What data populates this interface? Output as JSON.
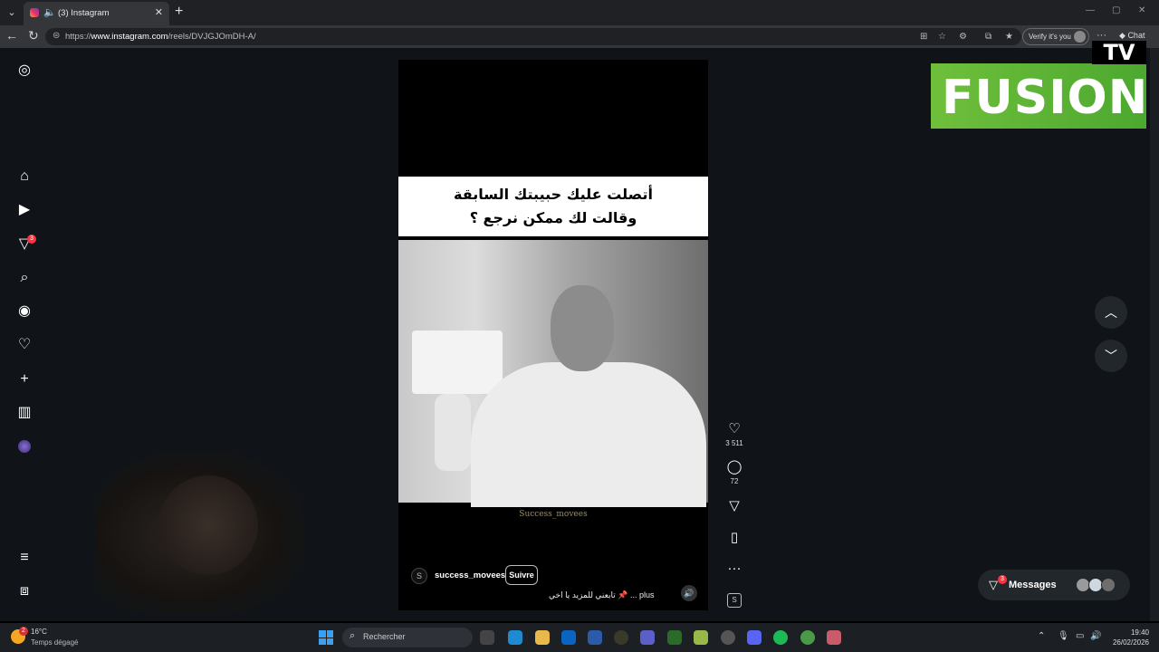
{
  "browser": {
    "tab_title": "(3) Instagram",
    "tab_favicon": "instagram-icon",
    "url_prefix": "https://",
    "url_domain": "www.instagram.com",
    "url_path": "/reels/DVJGJOmDH-A/",
    "verify_label": "Verify it's you",
    "chat_label": "Chat"
  },
  "sidebar": {
    "items": [
      {
        "name": "instagram-logo-icon"
      },
      {
        "name": "home-icon"
      },
      {
        "name": "reels-icon"
      },
      {
        "name": "direct-icon",
        "badge": "3"
      },
      {
        "name": "search-icon"
      },
      {
        "name": "explore-icon"
      },
      {
        "name": "heart-icon"
      },
      {
        "name": "plus-icon"
      },
      {
        "name": "insights-icon"
      },
      {
        "name": "profile-avatar"
      },
      {
        "name": "menu-icon"
      },
      {
        "name": "threads-icon"
      }
    ]
  },
  "reel": {
    "caption_line1": "أتصلت عليك حبيبتك السابقة",
    "caption_line2": "وقالت لك ممكن نرجع ؟",
    "watermark": "Success_movees",
    "author_initial": "S",
    "author": "success_movees",
    "follow_label": "Suivre",
    "description": "تابعني للمزيد يا اخي 📌 ... plus",
    "likes": "3 511",
    "comments": "72",
    "audio_icon": "S"
  },
  "messages": {
    "label": "Messages",
    "badge": "3"
  },
  "overlay_logo": {
    "top": "TV",
    "main": "FUSION",
    "color": "#5cb335"
  },
  "taskbar": {
    "weather_temp": "16°C",
    "weather_desc": "Temps dégagé",
    "weather_badge": "2",
    "search_placeholder": "Rechercher",
    "time": "19:40",
    "date": "26/02/2026"
  }
}
